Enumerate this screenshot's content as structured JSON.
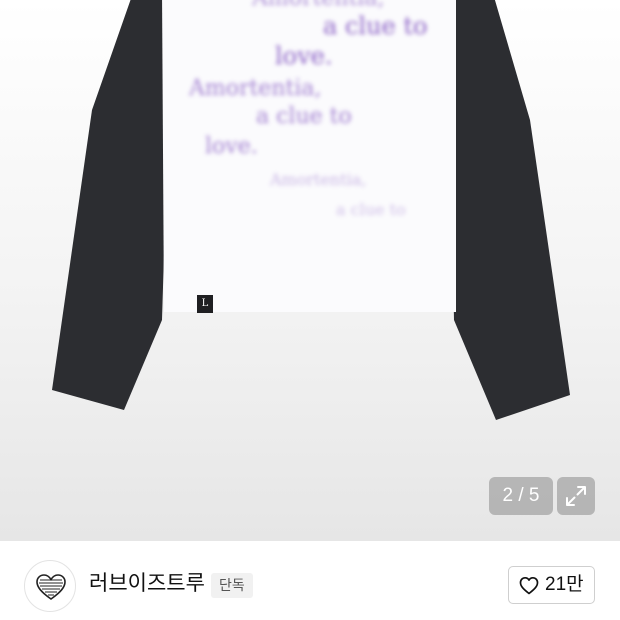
{
  "product_image": {
    "print_lines": [
      "a clue to",
      "love.",
      "Amortentia,",
      "a clue to",
      "love.",
      "Amortentia,",
      "a clue to"
    ],
    "tag_glyph": "L"
  },
  "gallery": {
    "counter": "2 / 5",
    "expand_icon": "expand-icon"
  },
  "seller": {
    "logo_icon": "brand-heart-logo",
    "name": "러브이즈트루",
    "badge": "단독"
  },
  "like": {
    "icon": "heart-outline-icon",
    "count": "21만"
  },
  "colors": {
    "sleeve": "#2c2d31",
    "print": "#8c62c6",
    "overlay": "#969696"
  }
}
